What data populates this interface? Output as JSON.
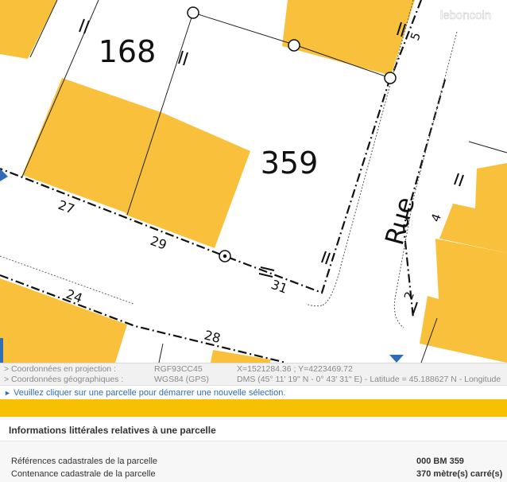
{
  "map": {
    "parcel_numbers": [
      "168",
      "359"
    ],
    "street_label": "Rue",
    "edge_lengths": [
      "27",
      "29",
      "31",
      "24",
      "28"
    ],
    "house_numbers": [
      "5",
      "4",
      "2"
    ],
    "watermark": "leboncoin",
    "colors": {
      "building": "#f9c13b",
      "parcel_line": "#222222"
    }
  },
  "coordinates": {
    "projection_label": "> Coordonnées en projection :",
    "projection_system": "RGF93CC45",
    "projection_value": "X=1521284.36 ; Y=4223469.72",
    "geo_label": "> Coordonnées géographiques :",
    "geo_system": "WGS84 (GPS)",
    "geo_value": "DMS (45° 11' 19\" N - 0° 43' 31\" E) - Latitude = 45.188627 N - Longitude"
  },
  "message": {
    "arrow": "►",
    "text": "Veuillez cliquer sur une parcelle pour démarrer une nouvelle sélection."
  },
  "info_panel": {
    "title": "Informations littérales relatives à une parcelle",
    "rows": [
      {
        "label": "Références cadastrales de la parcelle",
        "value": "000 BM 359"
      },
      {
        "label": "Contenance cadastrale de la parcelle",
        "value": "370 mètre(s) carré(s)"
      }
    ]
  },
  "colors": {
    "accent": "#f6c100",
    "link": "#2f6db4"
  }
}
